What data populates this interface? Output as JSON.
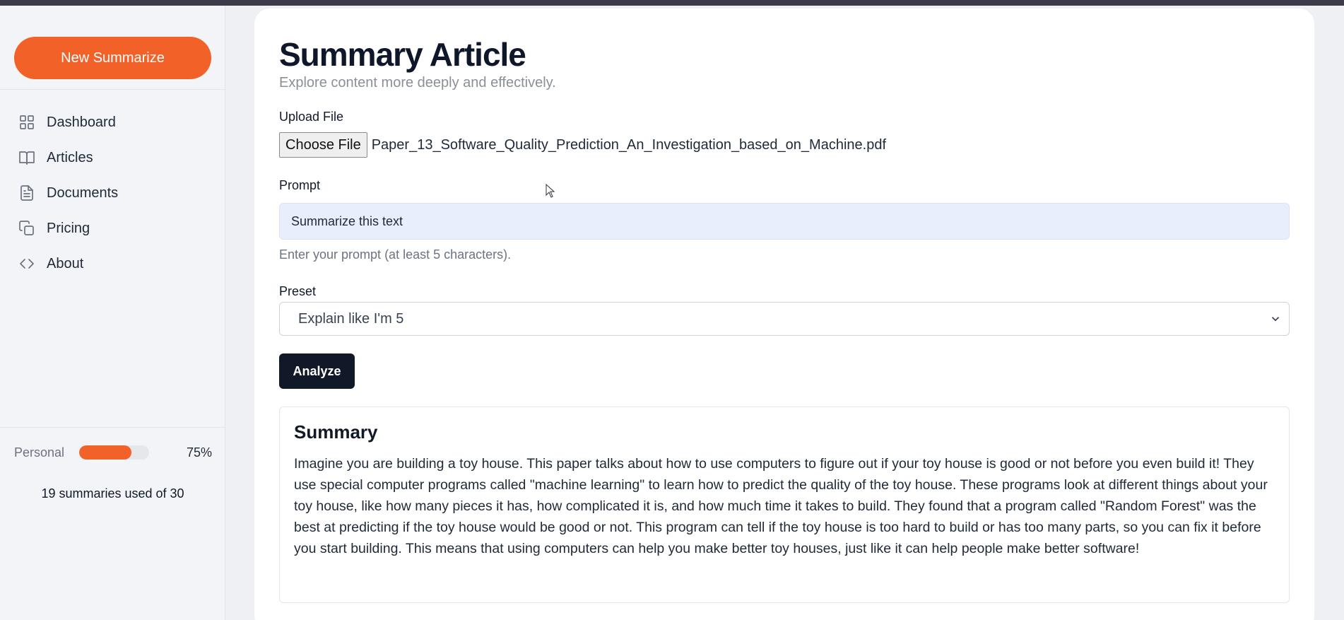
{
  "sidebar": {
    "new_button_label": "New Summarize",
    "items": [
      {
        "label": "Dashboard",
        "icon": "grid-icon"
      },
      {
        "label": "Articles",
        "icon": "book-icon"
      },
      {
        "label": "Documents",
        "icon": "document-icon"
      },
      {
        "label": "Pricing",
        "icon": "copy-icon"
      },
      {
        "label": "About",
        "icon": "code-icon"
      }
    ],
    "usage": {
      "plan": "Personal",
      "percent_label": "75%",
      "percent": 0.75,
      "summary": "19 summaries used of 30"
    }
  },
  "main": {
    "title": "Summary Article",
    "subtitle": "Explore content more deeply and effectively.",
    "upload_label": "Upload File",
    "choose_file_label": "Choose File",
    "file_name": "Paper_13_Software_Quality_Prediction_An_Investigation_based_on_Machine.pdf",
    "prompt_label": "Prompt",
    "prompt_value": "Summarize this text",
    "prompt_hint": "Enter your prompt (at least 5 characters).",
    "preset_label": "Preset",
    "preset_value": "Explain like I'm 5",
    "analyze_label": "Analyze",
    "summary_title": "Summary",
    "summary_text": "Imagine you are building a toy house. This paper talks about how to use computers to figure out if your toy house is good or not before you even build it! They use special computer programs called \"machine learning\" to learn how to predict the quality of the toy house. These programs look at different things about your toy house, like how many pieces it has, how complicated it is, and how much time it takes to build. They found that a program called \"Random Forest\" was the best at predicting if the toy house would be good or not. This program can tell if the toy house is too hard to build or has too many parts, so you can fix it before you start building. This means that using computers can help you make better toy houses, just like it can help people make better software!"
  },
  "colors": {
    "accent": "#f26128",
    "dark_button": "#111827",
    "input_bg": "#e8eefb"
  }
}
